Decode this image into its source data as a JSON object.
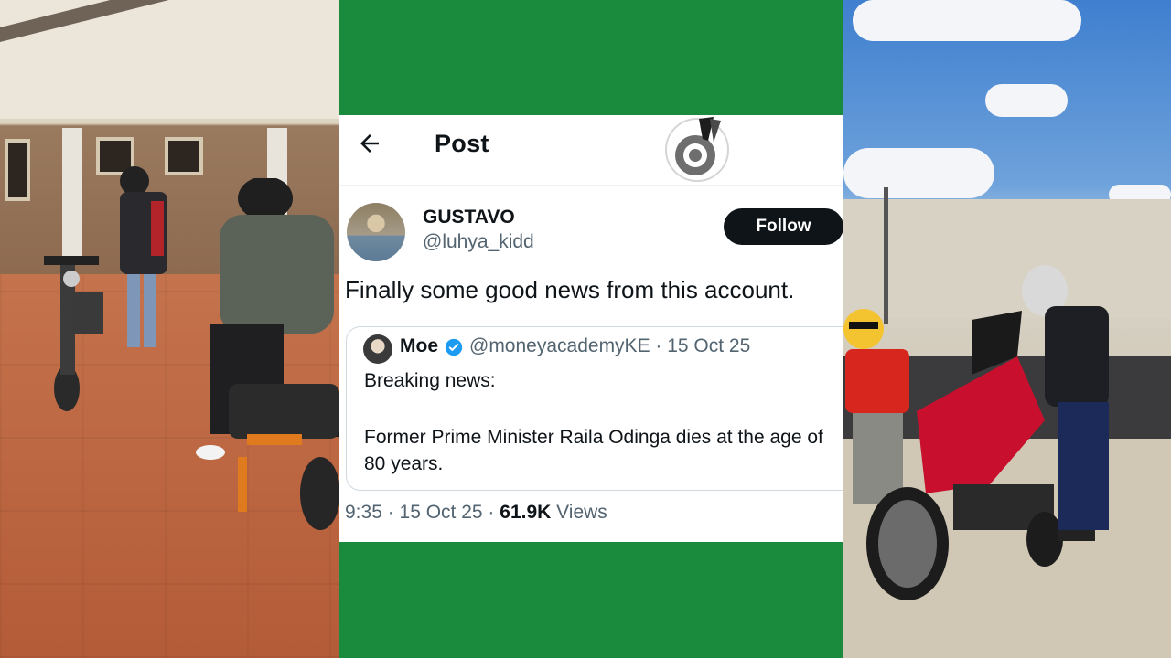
{
  "colors": {
    "background_green": "#1a8a3c",
    "follow_bg": "#0f1419",
    "verified": "#1d9bf0"
  },
  "header": {
    "back_icon": "arrow-left-icon",
    "title": "Post",
    "logo_icon": "brand-logo-icon"
  },
  "tweet": {
    "display_name": "GUSTAVO",
    "handle": "@luhya_kidd",
    "follow_label": "Follow",
    "text": "Finally some good news from this account."
  },
  "quote": {
    "name": "Moe",
    "verified_icon": "verified-badge-icon",
    "handle_date": "@moneyacademyKE · 15 Oct 25",
    "line1": "Breaking news:",
    "line2": "Former Prime Minister Raila Odinga dies at the age of 80 years."
  },
  "meta": {
    "time_date": "9:35 · 15 Oct 25 · ",
    "views_count": "61.9K",
    "views_label": " Views"
  },
  "photos": {
    "left_description_icon": "photo-motorcycles-driveway",
    "right_description_icon": "photo-motorcycle-station"
  }
}
